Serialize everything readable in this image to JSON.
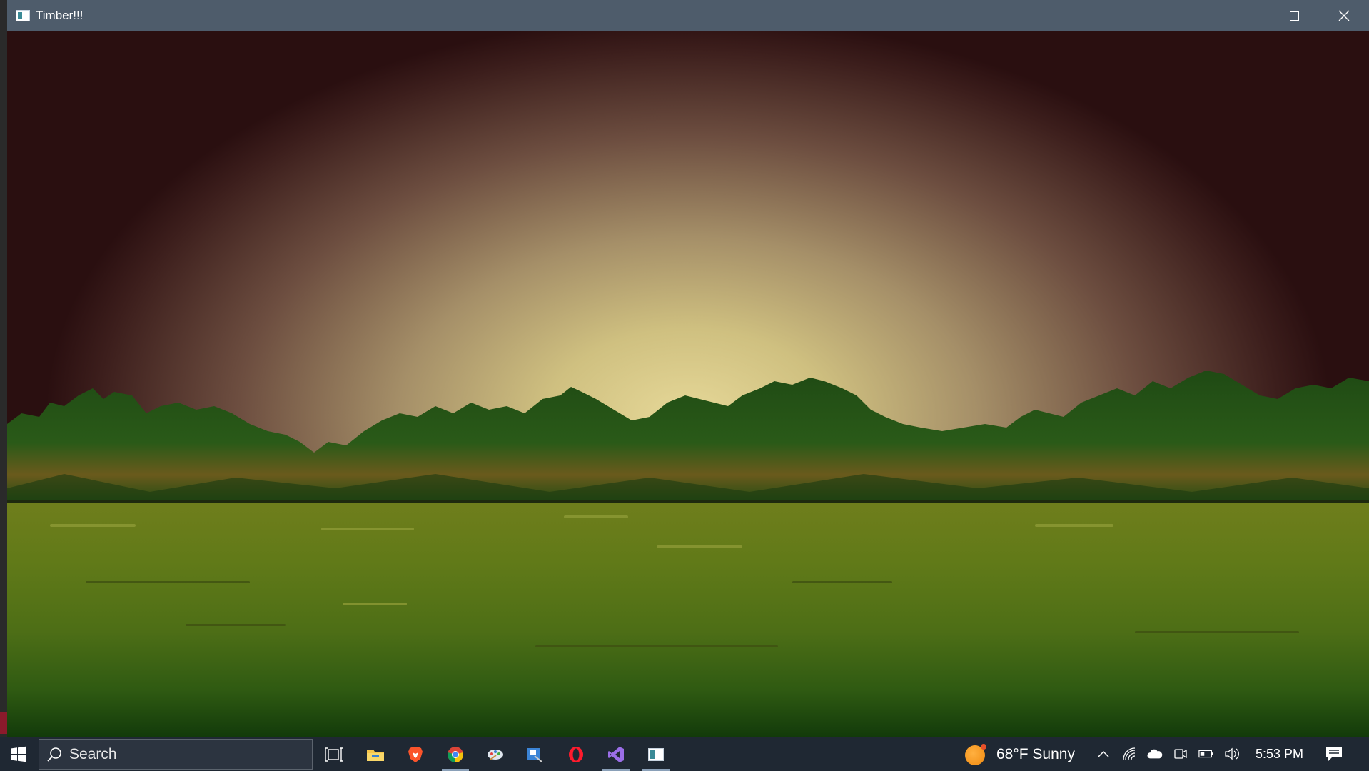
{
  "window": {
    "title": "Timber!!!",
    "controls": [
      "minimize",
      "maximize",
      "close"
    ]
  },
  "game": {
    "scene": "forest-background",
    "sky_colors": [
      "#e6d898",
      "#a58f68",
      "#6d4e40",
      "#2a0f10"
    ],
    "ground_color": "#617a18"
  },
  "taskbar": {
    "search_placeholder": "Search",
    "apps": [
      {
        "name": "task-view-icon",
        "active": false
      },
      {
        "name": "file-explorer-icon",
        "active": false
      },
      {
        "name": "brave-browser-icon",
        "active": false
      },
      {
        "name": "chrome-icon",
        "active": true
      },
      {
        "name": "paint-tool-icon",
        "active": false
      },
      {
        "name": "snipping-tool-icon",
        "active": false
      },
      {
        "name": "opera-icon",
        "active": false
      },
      {
        "name": "visual-studio-icon",
        "active": true
      },
      {
        "name": "timber-app-icon",
        "active": true
      }
    ],
    "weather": "68°F  Sunny",
    "clock": "5:53 PM",
    "tray_icons": [
      "chevron-up-icon",
      "wifi-icon",
      "onedrive-cloud-icon",
      "meet-now-icon",
      "battery-icon",
      "volume-icon"
    ],
    "accent_color": "#1f2833"
  }
}
